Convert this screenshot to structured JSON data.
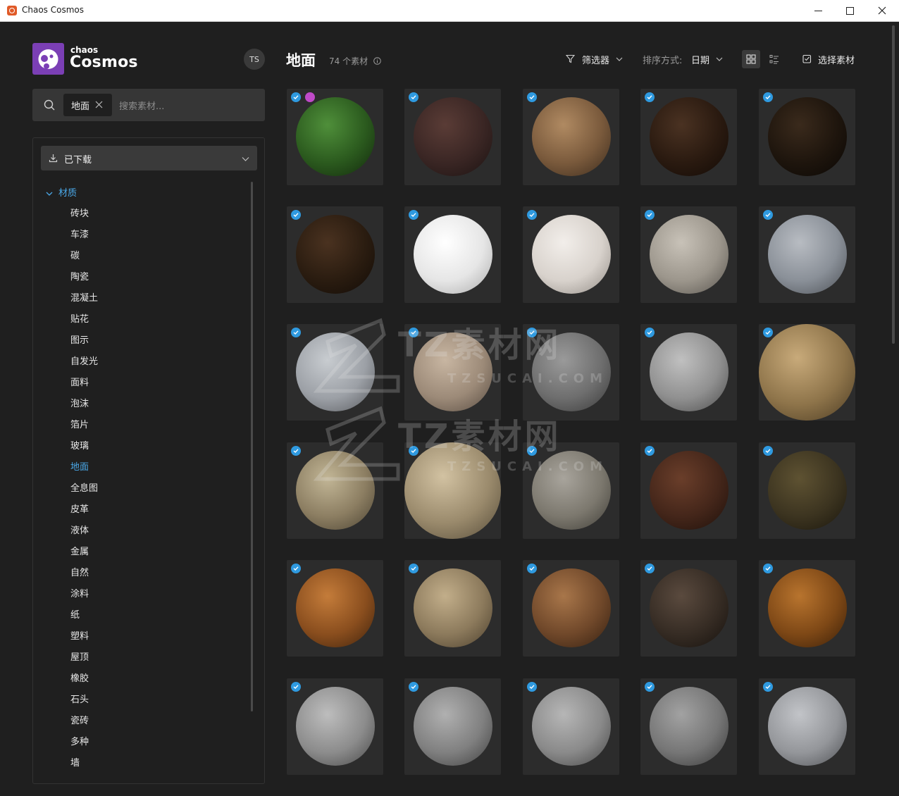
{
  "window": {
    "title": "Chaos Cosmos"
  },
  "brand": {
    "small": "chaos",
    "big": "Cosmos",
    "color": "#7b3fb5"
  },
  "user": {
    "initials": "TS"
  },
  "search": {
    "chip": "地面",
    "placeholder": "搜索素材..."
  },
  "filter_source": {
    "label": "已下载"
  },
  "tree": {
    "root": "材质",
    "items": [
      "砖块",
      "车漆",
      "碳",
      "陶瓷",
      "混凝土",
      "贴花",
      "图示",
      "自发光",
      "面料",
      "泡沫",
      "箔片",
      "玻璃",
      "地面",
      "全息图",
      "皮革",
      "液体",
      "金属",
      "自然",
      "涂料",
      "纸",
      "塑料",
      "屋顶",
      "橡胶",
      "石头",
      "瓷砖",
      "多种",
      "墙"
    ],
    "active": "地面"
  },
  "header": {
    "title": "地面",
    "count": "74 个素材",
    "filter": "筛选器",
    "sort_label": "排序方式:",
    "sort_value": "日期",
    "select": "选择素材"
  },
  "accent": "#4aa8e8",
  "watermark": {
    "text": "TZ素材网",
    "url": "TZSUCAI.COM"
  },
  "assets": [
    {
      "material": "grass",
      "downloaded": true,
      "extra_badge": true
    },
    {
      "material": "dark-mud",
      "downloaded": true
    },
    {
      "material": "sandy-soil",
      "downloaded": true
    },
    {
      "material": "dark-soil",
      "downloaded": true
    },
    {
      "material": "black-soil",
      "downloaded": true
    },
    {
      "material": "dark-earth",
      "downloaded": true
    },
    {
      "material": "snow",
      "downloaded": true
    },
    {
      "material": "white-speckled",
      "downloaded": true
    },
    {
      "material": "grey-tiles",
      "downloaded": true
    },
    {
      "material": "blue-grey-tiles",
      "downloaded": true
    },
    {
      "material": "grey-blocks",
      "downloaded": true
    },
    {
      "material": "beige-tiles",
      "downloaded": true
    },
    {
      "material": "small-grey-tiles",
      "downloaded": true
    },
    {
      "material": "grey-mosaic",
      "downloaded": true
    },
    {
      "material": "rocky-ground",
      "downloaded": true
    },
    {
      "material": "weathered-stone",
      "downloaded": true
    },
    {
      "material": "crumbled-rock",
      "downloaded": true
    },
    {
      "material": "gravel",
      "downloaded": true
    },
    {
      "material": "forest-soil",
      "downloaded": true
    },
    {
      "material": "mossy-ground",
      "downloaded": true
    },
    {
      "material": "wood-chips",
      "downloaded": true
    },
    {
      "material": "fine-gravel",
      "downloaded": true
    },
    {
      "material": "leafy-ground",
      "downloaded": true
    },
    {
      "material": "dark-rubble",
      "downloaded": true
    },
    {
      "material": "bark-mulch",
      "downloaded": true
    },
    {
      "material": "stone-grid",
      "downloaded": true
    },
    {
      "material": "brick-pavers",
      "downloaded": true
    },
    {
      "material": "herringbone-pavers",
      "downloaded": true
    },
    {
      "material": "grey-concrete",
      "downloaded": true
    },
    {
      "material": "light-concrete",
      "downloaded": true
    }
  ]
}
